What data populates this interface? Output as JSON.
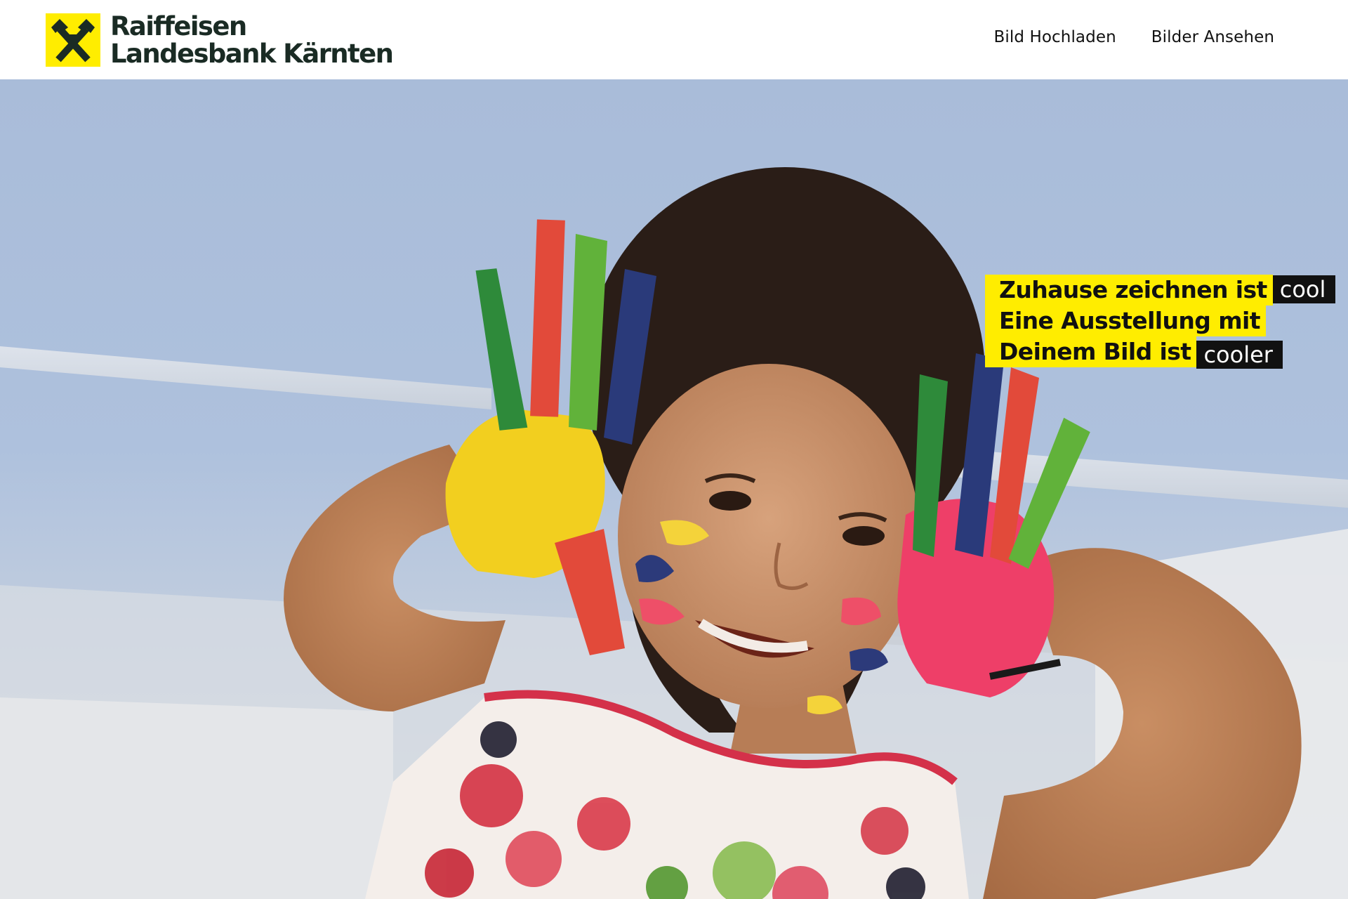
{
  "brand": {
    "line1": "Raiffeisen",
    "line2": "Landesbank Kärnten",
    "logo_icon": "raiffeisen-gable-cross-icon",
    "brand_color": "#ffed00"
  },
  "nav": {
    "items": [
      {
        "label": "Bild Hochladen"
      },
      {
        "label": "Bilder Ansehen"
      }
    ]
  },
  "hero": {
    "line1": "Zuhause zeichnen ist",
    "line1_badge": "cool",
    "line2": "Eine Ausstellung mit",
    "line3": "Deinem Bild ist",
    "line3_badge": "cooler"
  }
}
